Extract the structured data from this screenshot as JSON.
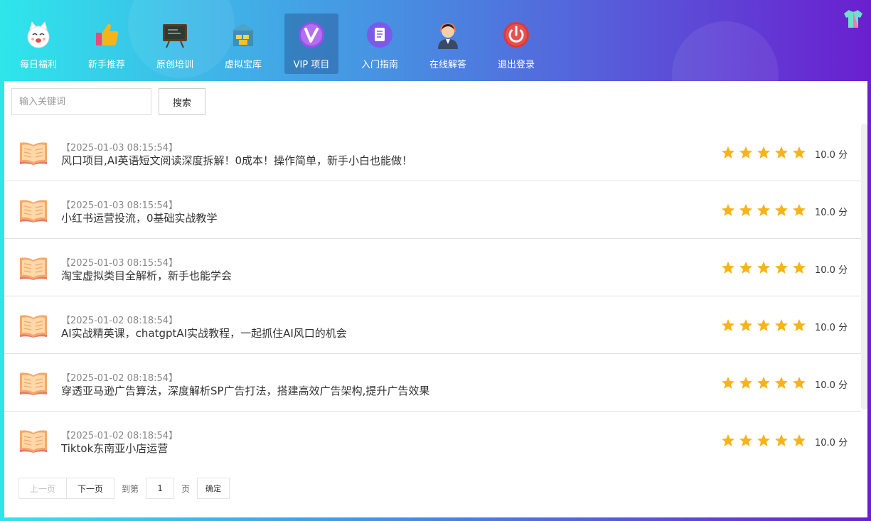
{
  "nav": {
    "items": [
      {
        "label": "每日福利",
        "icon": "lucky-cat-icon"
      },
      {
        "label": "新手推荐",
        "icon": "thumbs-up-icon"
      },
      {
        "label": "原创培训",
        "icon": "blackboard-icon"
      },
      {
        "label": "虚拟宝库",
        "icon": "treasure-vault-icon"
      },
      {
        "label": "VIP 项目",
        "icon": "vip-icon",
        "active": true
      },
      {
        "label": "入门指南",
        "icon": "document-icon"
      },
      {
        "label": "在线解答",
        "icon": "support-agent-icon"
      },
      {
        "label": "退出登录",
        "icon": "power-icon"
      }
    ],
    "skin_icon": "tshirt-icon"
  },
  "search": {
    "placeholder": "输入关键词",
    "button_label": "搜索"
  },
  "list": {
    "items": [
      {
        "date": "【2025-01-03 08:15:54】",
        "title": "风口项目,AI英语短文阅读深度拆解！0成本！操作简单，新手小白也能做！",
        "score": "10.0 分",
        "rating": 5
      },
      {
        "date": "【2025-01-03 08:15:54】",
        "title": "小红书运营投流，0基础实战教学",
        "score": "10.0 分",
        "rating": 5
      },
      {
        "date": "【2025-01-03 08:15:54】",
        "title": "淘宝虚拟类目全解析，新手也能学会",
        "score": "10.0 分",
        "rating": 5
      },
      {
        "date": "【2025-01-02 08:18:54】",
        "title": "AI实战精英课，chatgptAI实战教程，一起抓住AI风口的机会",
        "score": "10.0 分",
        "rating": 5
      },
      {
        "date": "【2025-01-02 08:18:54】",
        "title": "穿透亚马逊广告算法，深度解析SP广告打法，搭建高效广告架构,提升广告效果",
        "score": "10.0 分",
        "rating": 5
      },
      {
        "date": "【2025-01-02 08:18:54】",
        "title": "Tiktok东南亚小店运营",
        "score": "10.0 分",
        "rating": 5
      }
    ]
  },
  "pager": {
    "prev_label": "上一页",
    "next_label": "下一页",
    "goto_label": "到第",
    "page_value": "1",
    "page_suffix": "页",
    "confirm_label": "确定"
  },
  "colors": {
    "star": "#f7b418",
    "book": "#f6a86a",
    "gradient_start": "#2ee6ea",
    "gradient_end": "#6a1fcf"
  }
}
